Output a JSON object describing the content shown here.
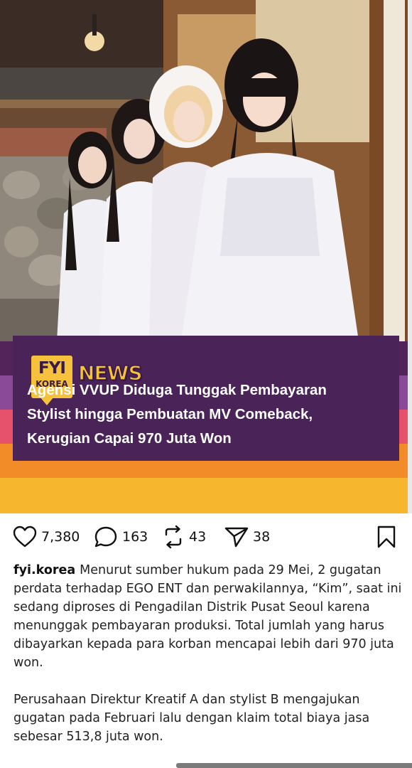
{
  "post": {
    "badge": {
      "brand_top": "FYI",
      "brand_bottom": "KOREA",
      "label": "NEWS"
    },
    "headline_lines": [
      "Agensi VVUP Diduga Tunggak Pembayaran",
      "Stylist hingga Pembuatan MV Comeback,",
      "Kerugian Capai 970 Juta Won"
    ],
    "colors": {
      "card": "#4a2358",
      "accent_yellow": "#f7c23b",
      "stripe_purple": "#522459",
      "stripe_violet": "#8a4a98",
      "stripe_pink": "#e6516b",
      "stripe_orange": "#f28c28",
      "stripe_yellow": "#f6b72e"
    }
  },
  "actions": {
    "likes": "7,380",
    "comments": "163",
    "reposts": "43",
    "shares": "38",
    "icons": [
      "heart-icon",
      "comment-icon",
      "repost-icon",
      "send-icon",
      "bookmark-icon"
    ]
  },
  "caption": {
    "username": "fyi.korea",
    "paragraph1": "Menurut sumber hukum pada 29 Mei, 2 gugatan perdata terhadap EGO ENT dan perwakilannya, “Kim”, saat ini sedang diproses di Pengadilan Distrik Pusat Seoul karena menunggak pembayaran produksi. Total jumlah yang harus dibayarkan kepada para korban mencapai lebih dari 970 juta won.",
    "paragraph2": "Perusahaan Direktur Kreatif A dan stylist B mengajukan gugatan pada Februari lalu dengan klaim total biaya jasa sebesar 513,8 juta won."
  }
}
